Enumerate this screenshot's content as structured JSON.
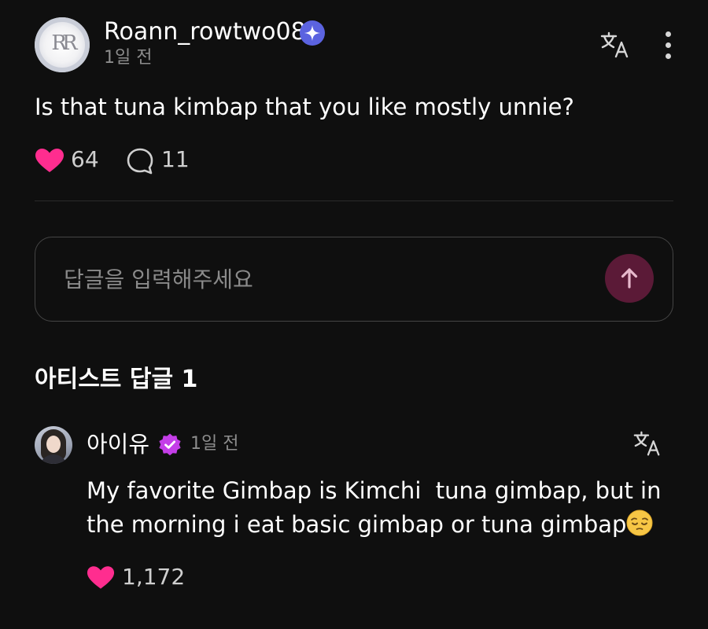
{
  "post": {
    "avatar_monogram": "RR",
    "username": "Roann_rowtwo08",
    "time": "1일 전",
    "text": "Is that tuna kimbap that you like mostly unnie?",
    "likes": "64",
    "comments": "11"
  },
  "reply_box": {
    "placeholder": "답글을 입력해주세요"
  },
  "artist_section": {
    "title": "아티스트 답글 1"
  },
  "artist_reply": {
    "author": "아이유",
    "time": "1일 전",
    "text_line1": "My favorite Gimbap is Kimchi  tuna gimbap, but in",
    "text_line2": "the morning i eat basic gimbap or tuna gimbap",
    "likes": "1,172"
  },
  "icons": {
    "verified": "verified-star-icon",
    "translate": "translate-icon",
    "more": "more-vertical-icon",
    "like": "heart-icon",
    "comment": "comment-bubble-icon",
    "send": "arrow-up-icon",
    "artist_badge": "artist-check-badge-icon",
    "emoji": "pensive-face-emoji"
  },
  "colors": {
    "background": "#0f0f0f",
    "heart": "#ff2d8f",
    "verified": "#5b63e0",
    "artist_badge": "#c43ee8",
    "send_button": "#5b1a37",
    "muted_text": "#8d8d8d"
  }
}
